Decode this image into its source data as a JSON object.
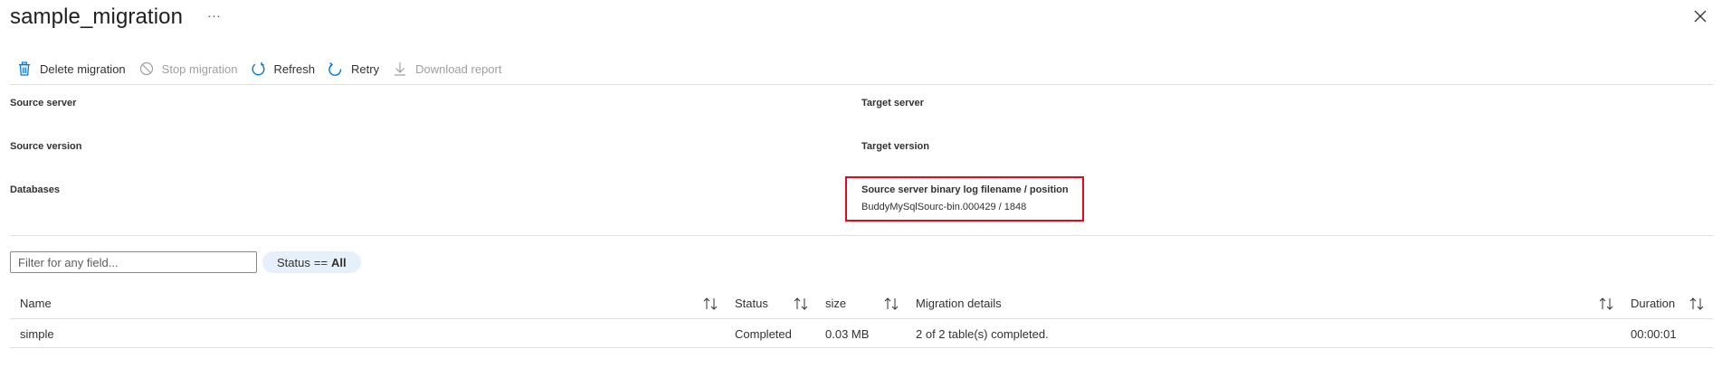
{
  "header": {
    "title": "sample_migration",
    "more_label": "···"
  },
  "toolbar": {
    "delete_label": "Delete migration",
    "stop_label": "Stop migration",
    "refresh_label": "Refresh",
    "retry_label": "Retry",
    "download_label": "Download report"
  },
  "properties": {
    "source_server_label": "Source server",
    "source_version_label": "Source version",
    "databases_label": "Databases",
    "target_server_label": "Target server",
    "target_version_label": "Target version",
    "binlog_label": "Source server binary log filename / position",
    "binlog_value": "BuddyMySqlSourc-bin.000429 / 1848"
  },
  "filter": {
    "placeholder": "Filter for any field...",
    "status_key": "Status",
    "status_op": "==",
    "status_value": "All"
  },
  "table": {
    "columns": [
      "Name",
      "Status",
      "size",
      "Migration details",
      "Duration"
    ],
    "rows": [
      {
        "name": "simple",
        "status": "Completed",
        "size": "0.03 MB",
        "details": "2 of 2 table(s) completed.",
        "duration": "00:00:01"
      }
    ]
  },
  "colors": {
    "accent": "#0078d4",
    "highlight_border": "#e00b1c",
    "pill_background": "#e6f0fa",
    "disabled_text": "#a19f9d"
  },
  "icons": [
    "more-icon",
    "close-icon",
    "trash-icon",
    "stop-icon",
    "refresh-icon",
    "retry-icon",
    "download-icon",
    "sort-icon"
  ]
}
